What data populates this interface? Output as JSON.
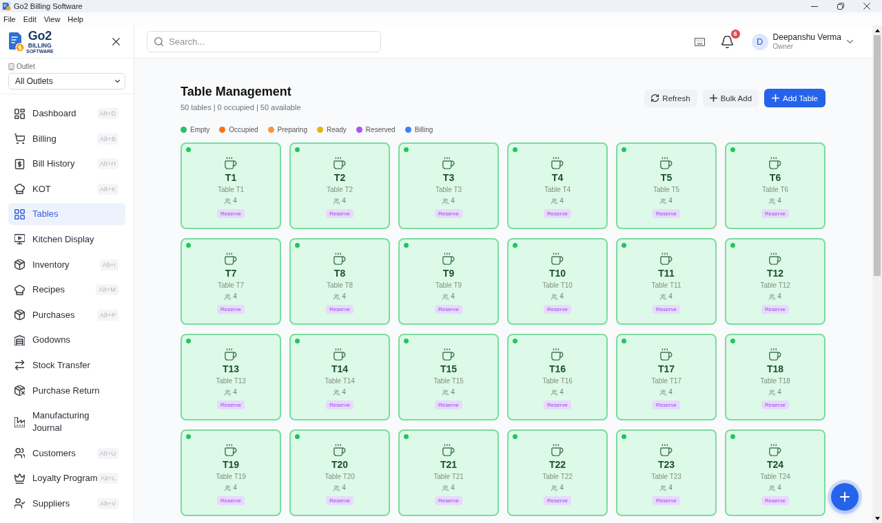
{
  "window": {
    "title": "Go2 Billing Software"
  },
  "menu_bar": [
    {
      "label": "File"
    },
    {
      "label": "Edit"
    },
    {
      "label": "View"
    },
    {
      "label": "Help"
    }
  ],
  "sidebar": {
    "logo": {
      "brand": "Go2",
      "line_1": "BILLING",
      "line_2": "SOFTWARE"
    },
    "outlet": {
      "label": "Outlet",
      "value": "All Outlets"
    },
    "items": [
      {
        "label": "Dashboard",
        "shortcut": "Alt+D",
        "selected": false
      },
      {
        "label": "Billing",
        "shortcut": "Alt+B",
        "selected": false
      },
      {
        "label": "Bill History",
        "shortcut": "Alt+H",
        "selected": false
      },
      {
        "label": "KOT",
        "shortcut": "Alt+K",
        "selected": false
      },
      {
        "label": "Tables",
        "selected": true
      },
      {
        "label": "Kitchen Display",
        "selected": false
      },
      {
        "label": "Inventory",
        "shortcut": "Alt+I",
        "selected": false
      },
      {
        "label": "Recipes",
        "shortcut": "Alt+M",
        "selected": false
      },
      {
        "label": "Purchases",
        "shortcut": "Alt+P",
        "selected": false
      },
      {
        "label": "Godowns",
        "selected": false
      },
      {
        "label": "Stock Transfer",
        "selected": false
      },
      {
        "label": "Purchase Return",
        "selected": false
      },
      {
        "label": "Manufacturing Journal",
        "selected": false
      },
      {
        "label": "Customers",
        "shortcut": "Alt+U",
        "selected": false
      },
      {
        "label": "Loyalty Program",
        "shortcut": "Alt+L",
        "selected": false
      },
      {
        "label": "Suppliers",
        "shortcut": "Alt+V",
        "selected": false
      }
    ]
  },
  "header": {
    "search": {
      "placeholder": "Search..."
    },
    "notifications": {
      "count": "6"
    },
    "user": {
      "initial": "D",
      "name": "Deepanshu Verma",
      "role": "Owner"
    }
  },
  "page": {
    "title": "Table Management",
    "summary": "50 tables | 0 occupied | 50 available",
    "buttons": [
      {
        "label": "Refresh",
        "kind": "refresh"
      },
      {
        "label": "Bulk Add",
        "kind": "add"
      },
      {
        "label": "Add Table",
        "kind": "primary"
      }
    ],
    "legend": [
      {
        "label": "Empty",
        "color": "#22c55e"
      },
      {
        "label": "Occupied",
        "color": "#f97316"
      },
      {
        "label": "Preparing",
        "color": "#fb923c"
      },
      {
        "label": "Ready",
        "color": "#eab308"
      },
      {
        "label": "Reserved",
        "color": "#a855f7"
      },
      {
        "label": "Billing",
        "color": "#3b82f6"
      }
    ],
    "tables": [
      {
        "number": "T1",
        "label": "Table T1",
        "seats": "4",
        "action": "Reserve",
        "color": "#22c55e"
      },
      {
        "number": "T2",
        "label": "Table T2",
        "seats": "4",
        "action": "Reserve",
        "color": "#22c55e"
      },
      {
        "number": "T3",
        "label": "Table T3",
        "seats": "4",
        "action": "Reserve",
        "color": "#22c55e"
      },
      {
        "number": "T4",
        "label": "Table T4",
        "seats": "4",
        "action": "Reserve",
        "color": "#22c55e"
      },
      {
        "number": "T5",
        "label": "Table T5",
        "seats": "4",
        "action": "Reserve",
        "color": "#22c55e"
      },
      {
        "number": "T6",
        "label": "Table T6",
        "seats": "4",
        "action": "Reserve",
        "color": "#22c55e"
      },
      {
        "number": "T7",
        "label": "Table T7",
        "seats": "4",
        "action": "Reserve",
        "color": "#22c55e"
      },
      {
        "number": "T8",
        "label": "Table T8",
        "seats": "4",
        "action": "Reserve",
        "color": "#22c55e"
      },
      {
        "number": "T9",
        "label": "Table T9",
        "seats": "4",
        "action": "Reserve",
        "color": "#22c55e"
      },
      {
        "number": "T10",
        "label": "Table T10",
        "seats": "4",
        "action": "Reserve",
        "color": "#22c55e"
      },
      {
        "number": "T11",
        "label": "Table T11",
        "seats": "4",
        "action": "Reserve",
        "color": "#22c55e"
      },
      {
        "number": "T12",
        "label": "Table T12",
        "seats": "4",
        "action": "Reserve",
        "color": "#22c55e"
      },
      {
        "number": "T13",
        "label": "Table T13",
        "seats": "4",
        "action": "Reserve",
        "color": "#22c55e"
      },
      {
        "number": "T14",
        "label": "Table T14",
        "seats": "4",
        "action": "Reserve",
        "color": "#22c55e"
      },
      {
        "number": "T15",
        "label": "Table T15",
        "seats": "4",
        "action": "Reserve",
        "color": "#22c55e"
      },
      {
        "number": "T16",
        "label": "Table T16",
        "seats": "4",
        "action": "Reserve",
        "color": "#22c55e"
      },
      {
        "number": "T17",
        "label": "Table T17",
        "seats": "4",
        "action": "Reserve",
        "color": "#22c55e"
      },
      {
        "number": "T18",
        "label": "Table T18",
        "seats": "4",
        "action": "Reserve",
        "color": "#22c55e"
      },
      {
        "number": "T19",
        "label": "Table T19",
        "seats": "4",
        "action": "Reserve",
        "color": "#22c55e"
      },
      {
        "number": "T20",
        "label": "Table T20",
        "seats": "4",
        "action": "Reserve",
        "color": "#22c55e"
      },
      {
        "number": "T21",
        "label": "Table T21",
        "seats": "4",
        "action": "Reserve",
        "color": "#22c55e"
      },
      {
        "number": "T22",
        "label": "Table T22",
        "seats": "4",
        "action": "Reserve",
        "color": "#22c55e"
      },
      {
        "number": "T23",
        "label": "Table T23",
        "seats": "4",
        "action": "Reserve",
        "color": "#22c55e"
      },
      {
        "number": "T24",
        "label": "Table T24",
        "seats": "4",
        "action": "Reserve",
        "color": "#22c55e"
      }
    ]
  }
}
